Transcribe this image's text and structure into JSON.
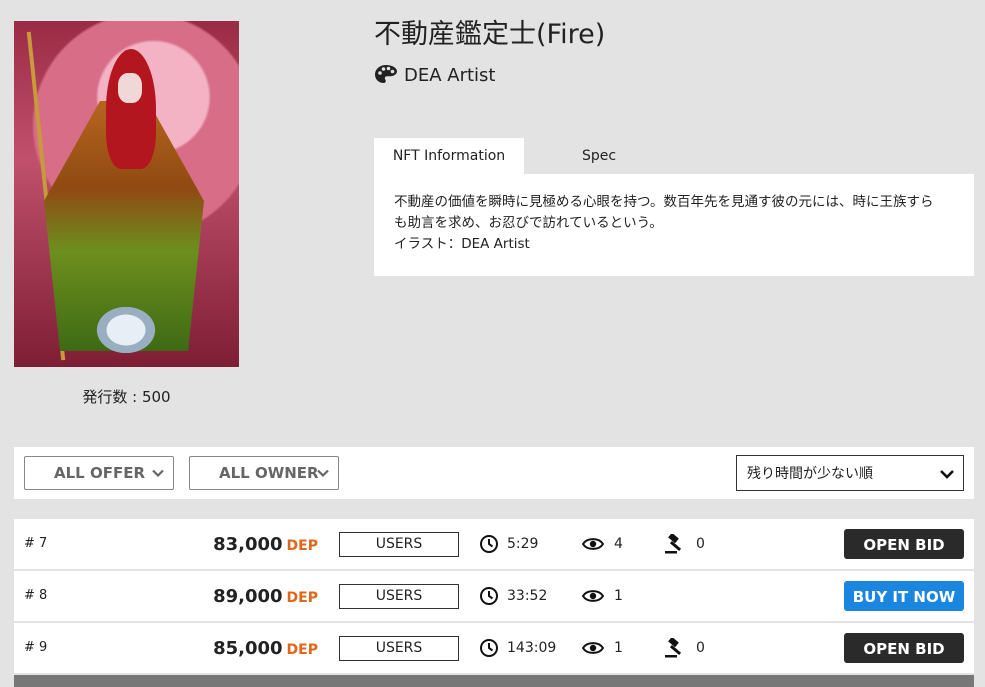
{
  "card": {
    "issue_count_label": "発行数 : 500"
  },
  "title": "不動産鑑定士(Fire)",
  "artist": {
    "icon": "palette-icon",
    "name": "DEA Artist"
  },
  "tabs": [
    {
      "label": "NFT Information",
      "active": true
    },
    {
      "label": "Spec",
      "active": false
    }
  ],
  "info": {
    "line1": "不動産の価値を瞬時に見極める心眼を持つ。数百年先を見通す彼の元には、時に王族すら",
    "line2": "も助言を求め、お忍びで訪れているという。",
    "line3": "イラスト：DEA Artist"
  },
  "filters": {
    "offer": "ALL OFFER",
    "owner": "ALL OWNER",
    "sort": "残り時間が少ない順"
  },
  "listings": [
    {
      "num": "# 7",
      "price": "83,000",
      "currency": "DEP",
      "seller": "USERS",
      "time": "5:29",
      "views": "4",
      "bids": "0",
      "action": "OPEN BID"
    },
    {
      "num": "# 8",
      "price": "89,000",
      "currency": "DEP",
      "seller": "USERS",
      "time": "33:52",
      "views": "1",
      "action": "BUY IT NOW"
    },
    {
      "num": "# 9",
      "price": "85,000",
      "currency": "DEP",
      "seller": "USERS",
      "time": "143:09",
      "views": "1",
      "bids": "0",
      "action": "OPEN BID"
    }
  ],
  "colors": {
    "currency": "#e0661a",
    "open_bid": "#2a2a2a",
    "buy_now": "#1a86e0"
  }
}
